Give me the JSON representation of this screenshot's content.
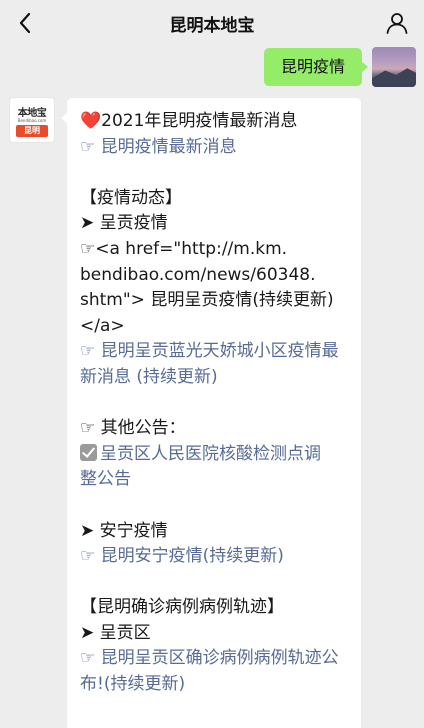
{
  "header": {
    "title": "昆明本地宝",
    "back_icon": "chevron-left-icon",
    "profile_icon": "person-icon"
  },
  "outgoing": {
    "text": "昆明疫情"
  },
  "sender": {
    "logo_text": "本地宝",
    "logo_url": "Bendibao.com",
    "logo_city": "昆明"
  },
  "message": {
    "headline_icon": "❤️",
    "headline": "2021年昆明疫情最新消息",
    "link1": "☞ 昆明疫情最新消息",
    "section1": "【疫情动态】",
    "sub1": "➤ 呈贡疫情",
    "raw1": "☞<a href=\"http://m.km.",
    "raw2": "bendibao.com/news/60348.",
    "raw3": "shtm\"> 昆明呈贡疫情(持续更新)",
    "raw4": "</a>",
    "link2a": "☞ 昆明呈贡蓝光天娇城小区疫情最",
    "link2b": "新消息 (持续更新)",
    "notice_label": "☞ 其他公告：",
    "link3a": "呈贡区人民医院核酸检测点调",
    "link3b": "整公告",
    "sub2": "➤ 安宁疫情",
    "link4": "☞ 昆明安宁疫情(持续更新)",
    "section2": "【昆明确诊病例病例轨迹】",
    "sub3": "➤ 呈贡区",
    "link5a": "☞ 昆明呈贡区确诊病例病例轨迹公",
    "link5b": "布!(持续更新)"
  },
  "colors": {
    "background": "#ededed",
    "bubble_out": "#95ec69",
    "bubble_in": "#ffffff",
    "link": "#576b95"
  }
}
